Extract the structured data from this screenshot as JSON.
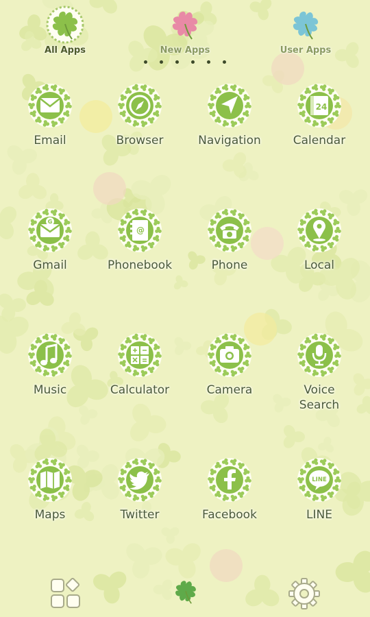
{
  "tabs": [
    {
      "label": "All Apps",
      "icon": "clover-green-icon",
      "active": true
    },
    {
      "label": "New Apps",
      "icon": "clover-pink-icon",
      "active": false
    },
    {
      "label": "User Apps",
      "icon": "clover-blue-icon",
      "active": false
    }
  ],
  "page_indicator": {
    "count": 6,
    "current": 1
  },
  "apps": [
    {
      "label": "Email",
      "icon": "envelope-icon"
    },
    {
      "label": "Browser",
      "icon": "compass-icon"
    },
    {
      "label": "Navigation",
      "icon": "navigation-arrow-icon"
    },
    {
      "label": "Calendar",
      "icon": "calendar-icon",
      "calendar_day": "24"
    },
    {
      "label": "Gmail",
      "icon": "gmail-envelope-icon"
    },
    {
      "label": "Phonebook",
      "icon": "address-book-icon"
    },
    {
      "label": "Phone",
      "icon": "telephone-icon"
    },
    {
      "label": "Local",
      "icon": "map-pin-icon"
    },
    {
      "label": "Music",
      "icon": "music-note-icon"
    },
    {
      "label": "Calculator",
      "icon": "calculator-icon"
    },
    {
      "label": "Camera",
      "icon": "camera-icon"
    },
    {
      "label": "Voice\nSearch",
      "icon": "microphone-icon"
    },
    {
      "label": "Maps",
      "icon": "folded-map-icon"
    },
    {
      "label": "Twitter",
      "icon": "twitter-bird-icon"
    },
    {
      "label": "Facebook",
      "icon": "facebook-f-icon"
    },
    {
      "label": "LINE",
      "icon": "line-bubble-icon",
      "badge_text": "LINE"
    }
  ],
  "dock": [
    {
      "icon": "widgets-grid-icon"
    },
    {
      "icon": "clover-home-icon"
    },
    {
      "icon": "settings-gear-icon"
    }
  ],
  "colors": {
    "background": "#eef2c2",
    "icon_green": "#8cc04a",
    "label_text": "#4b5a3a",
    "tab_active": "#4d5a2a",
    "tab_inactive": "#8a9a60"
  }
}
